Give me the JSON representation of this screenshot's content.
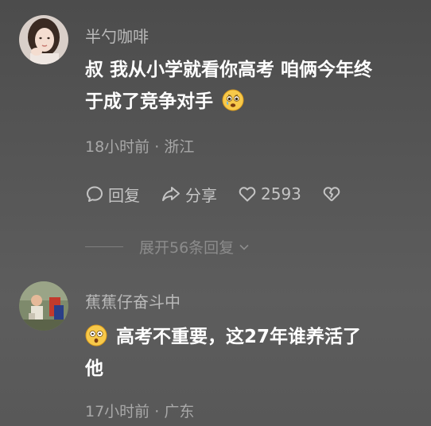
{
  "comments": [
    {
      "username": "半勺咖啡",
      "text_line1_before_emoji": "叔 我从小学就看你高考 咱俩今年终",
      "text_line2_before_emoji": "于成了竞争对手",
      "emoji_name": "crying-face-emoji",
      "time": "18小时前",
      "separator": "·",
      "location": "浙江",
      "actions": {
        "reply_label": "回复",
        "share_label": "分享",
        "like_count": "2593"
      },
      "expand_label": "展开56条回复"
    },
    {
      "username": "蕉蕉仔奋斗中",
      "emoji_name": "surprised-face-emoji",
      "text_line1_after_emoji": "高考不重要，这27年谁养活了",
      "text_line2": "他",
      "time": "17小时前",
      "separator": "·",
      "location": "广东"
    }
  ],
  "colors": {
    "username": "#b9b9b9",
    "content": "#ffffff",
    "meta": "#a8a8a8",
    "actions": "#c4c4c4",
    "expand": "#8c8c8c"
  }
}
